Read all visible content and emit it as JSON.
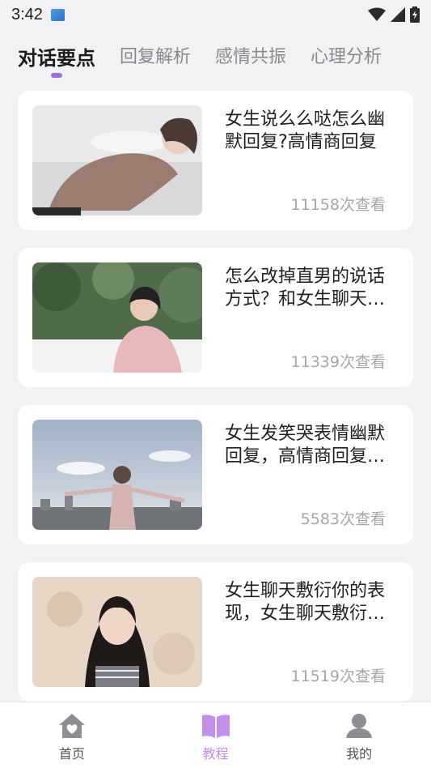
{
  "status": {
    "time": "3:42"
  },
  "tabs": [
    {
      "label": "对话要点",
      "active": true
    },
    {
      "label": "回复解析",
      "active": false
    },
    {
      "label": "感情共振",
      "active": false
    },
    {
      "label": "心理分析",
      "active": false
    }
  ],
  "articles": [
    {
      "title": "女生说么么哒怎么幽默回复?高情商回复",
      "views": "11158次查看",
      "image": "woman-lying-in-knit-sweater"
    },
    {
      "title": "怎么改掉直男的说话方式？和女生聊天技巧",
      "views": "11339次查看",
      "image": "girl-in-pink-sweater-garden"
    },
    {
      "title": "女生发笑哭表情幽默回复，高情商回复技巧",
      "views": "5583次查看",
      "image": "girl-arms-open-rooftop-city"
    },
    {
      "title": "女生聊天敷衍你的表现，女生聊天敷衍怎么办",
      "views": "11519次查看",
      "image": "girl-portrait-striped-top"
    }
  ],
  "bottom_nav": [
    {
      "label": "首页",
      "icon": "home-icon",
      "active": false
    },
    {
      "label": "教程",
      "icon": "book-icon",
      "active": true
    },
    {
      "label": "我的",
      "icon": "profile-icon",
      "active": false
    }
  ],
  "colors": {
    "accent": "#9b6fe0",
    "nav_active": "#c58ee8",
    "background": "#f2f2f4"
  }
}
